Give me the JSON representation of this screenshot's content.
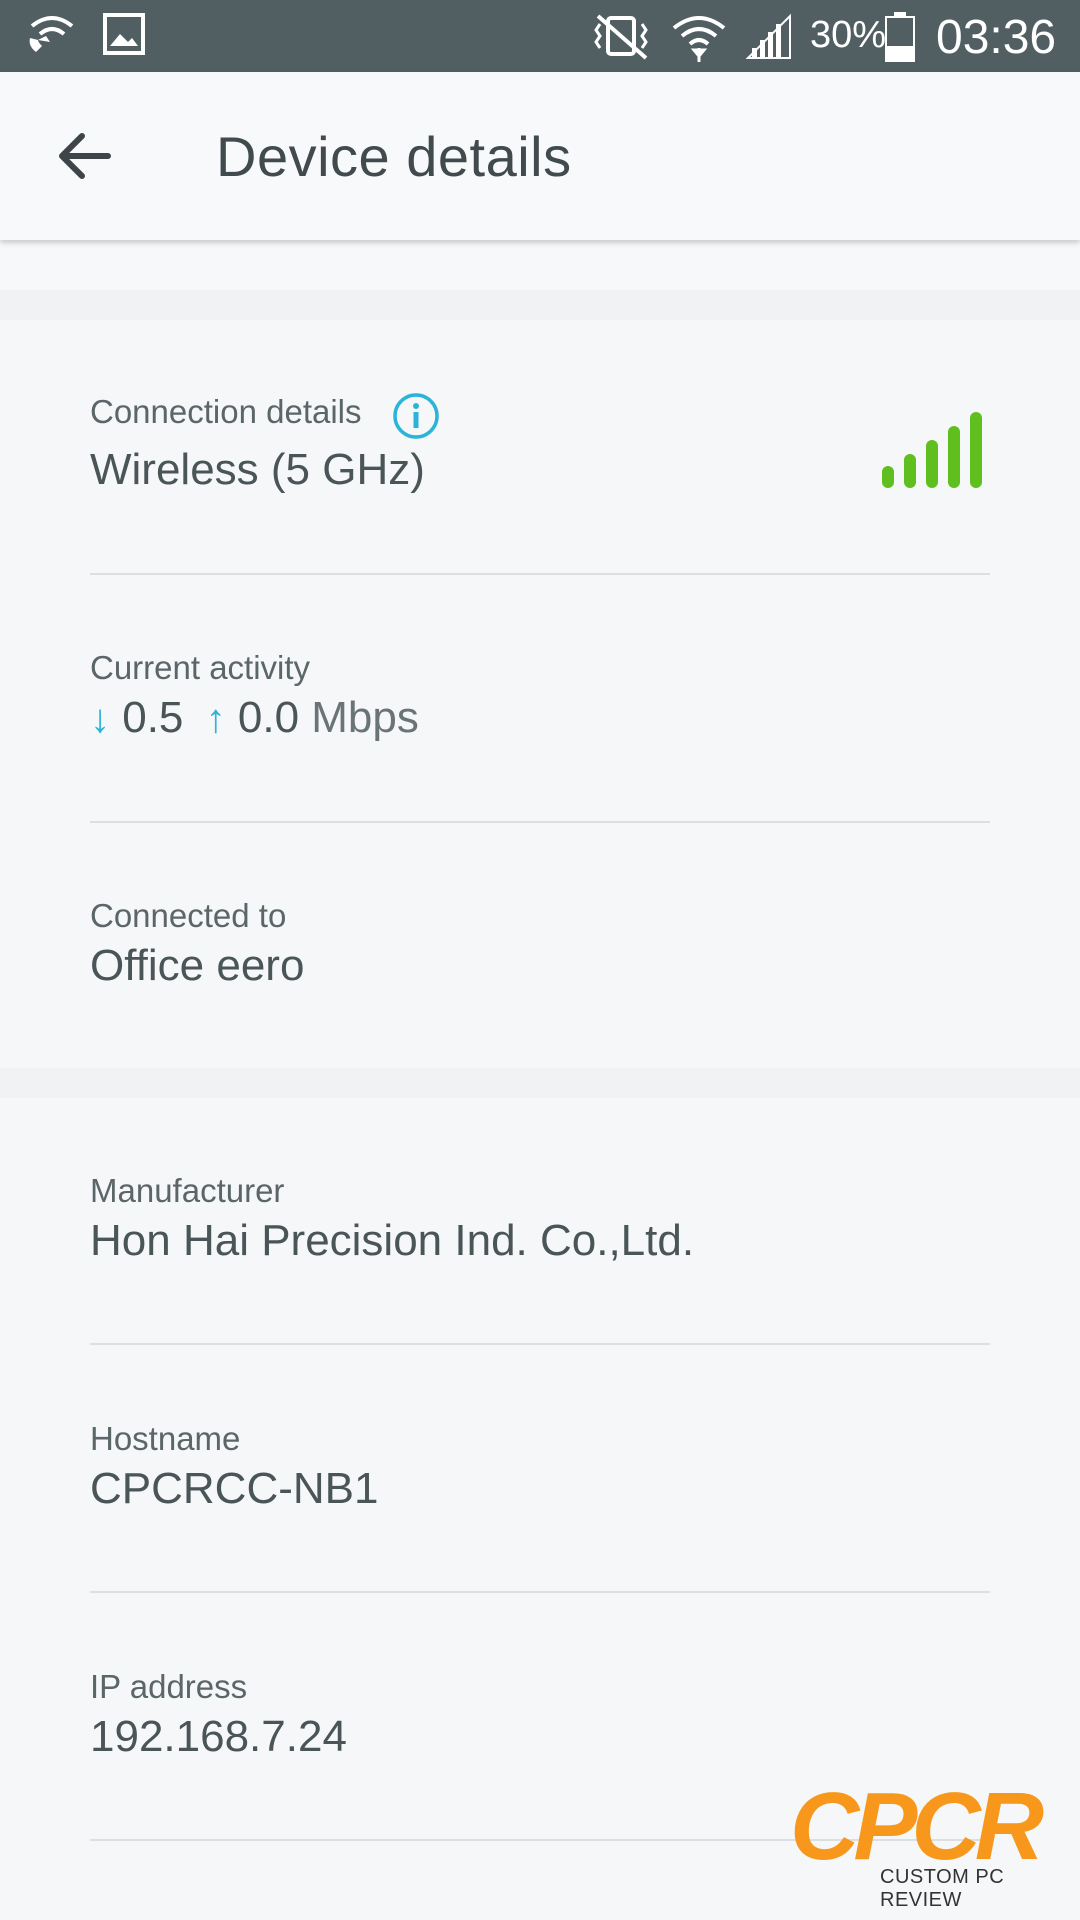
{
  "status_bar": {
    "battery_percent": "30%",
    "time": "03:36",
    "icons": [
      "wifi-calling-icon",
      "image-icon",
      "vibrate-icon",
      "wifi-icon",
      "cellular-signal-icon",
      "battery-icon"
    ]
  },
  "app_bar": {
    "title": "Device details",
    "back_icon": "arrow-left-icon"
  },
  "connection": {
    "label": "Connection details",
    "value": "Wireless (5 GHz)",
    "signal_color": "#5fbf1f",
    "info_color": "#2cb4d8"
  },
  "activity": {
    "label": "Current activity",
    "down_arrow": "↓",
    "down_value": "0.5",
    "up_arrow": "↑",
    "up_value": "0.0",
    "unit": "Mbps"
  },
  "connected_to": {
    "label": "Connected to",
    "value": "Office eero"
  },
  "manufacturer": {
    "label": "Manufacturer",
    "value": "Hon Hai Precision Ind. Co.,Ltd."
  },
  "hostname": {
    "label": "Hostname",
    "value": "CPCRCC-NB1"
  },
  "ip_address": {
    "label": "IP address",
    "value": "192.168.7.24"
  },
  "watermark": {
    "logo_text": "CPCR",
    "subtitle": "CUSTOM PC REVIEW"
  }
}
